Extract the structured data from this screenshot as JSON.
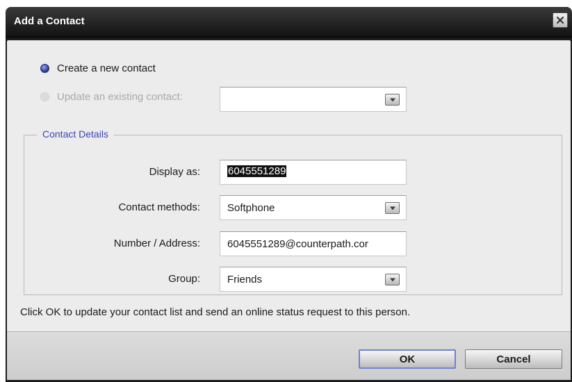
{
  "window": {
    "title": "Add a Contact"
  },
  "options": {
    "create_new": "Create a new contact",
    "update_existing": "Update an existing contact:",
    "update_existing_value": ""
  },
  "details": {
    "legend": "Contact Details",
    "display_label": "Display as:",
    "display_value": "6045551289",
    "methods_label": "Contact methods:",
    "methods_value": "Softphone",
    "address_label": "Number / Address:",
    "address_value": "6045551289@counterpath.cor",
    "group_label": "Group:",
    "group_value": "Friends"
  },
  "info_text": "Click OK to update your contact list and send an online status request to this person.",
  "buttons": {
    "ok": "OK",
    "cancel": "Cancel"
  },
  "colors": {
    "accent": "#3a45b8",
    "titlebar": "#1c1c1c",
    "selected_radio": "#3744a8"
  },
  "icons": {
    "close": "close-icon",
    "dropdown": "chevron-down-icon"
  }
}
